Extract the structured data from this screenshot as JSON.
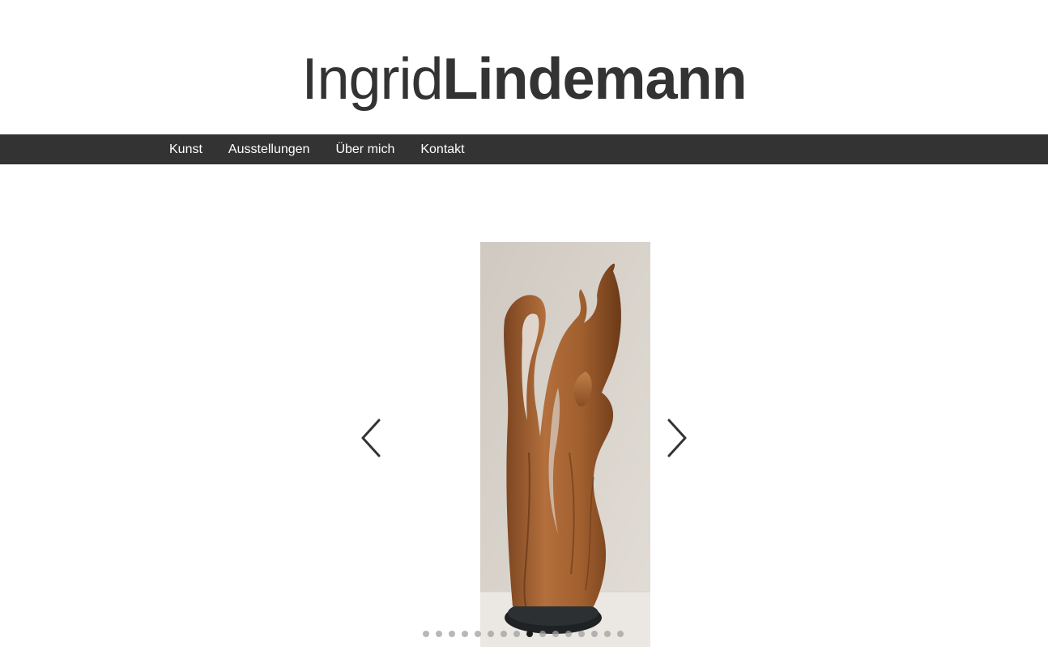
{
  "header": {
    "logo_first": "Ingrid",
    "logo_last": "Lindemann"
  },
  "nav": {
    "items": [
      {
        "label": "Kunst"
      },
      {
        "label": "Ausstellungen"
      },
      {
        "label": "Über mich"
      },
      {
        "label": "Kontakt"
      }
    ]
  },
  "slider": {
    "image_icon": "wood-sculpture-photo",
    "prev_icon": "chevron-left-icon",
    "next_icon": "chevron-right-icon",
    "slide_count": 16,
    "active_index": 8
  },
  "colors": {
    "text": "#333333",
    "navbar_bg": "#333333",
    "nav_text": "#ffffff",
    "dot": "#a0a0a0",
    "dot_active": "#1a1a1a"
  }
}
